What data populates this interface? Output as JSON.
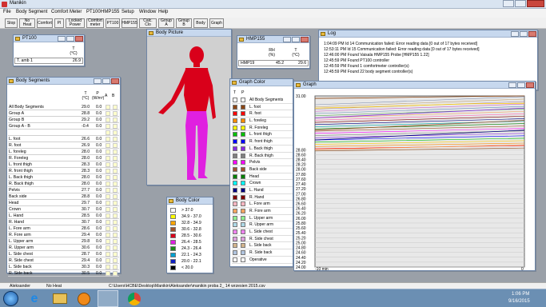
{
  "app": {
    "title": "Manikin"
  },
  "menu": [
    "File",
    "Body Segment",
    "Comfort Meter",
    "PT100",
    "HMP155",
    "Setup",
    "Window",
    "Help"
  ],
  "toolbar": [
    "Stop",
    "No Heat",
    "Comfort",
    "PI",
    "Locked Power",
    "Comfort meter",
    "PT100",
    "HMP155",
    "Calc. Clo",
    "Group A",
    "Group B",
    "Body",
    "Graph"
  ],
  "pt100": {
    "title": "PT100",
    "col": "T",
    "unit": "(°C)",
    "row_label": "T. amb 1",
    "row_value": "26.9"
  },
  "hmp": {
    "title": "HMP155",
    "col_rh": "RH",
    "unit_rh": "(%)",
    "col_t": "T",
    "unit_t": "(°C)",
    "row_label": "HMP19",
    "rh": "45.2",
    "t": "29.6"
  },
  "log": {
    "title": "Log",
    "lines": [
      "1:04:09 PM Id 14 Communication failed: Error reading data [0 out of 17 bytes received]",
      "12:53:11 PM Id 15 Communication failed: Error reading data [0 out of 17 bytes received]",
      "12:46:00 PM Found Vaisala HMP155 Probe [HMP155 1.22]",
      "12:45:59 PM Found PT100 controller",
      "12:45:59 PM Found 1 comfortmeter controller(s)",
      "12:45:59 PM Found 22 body segment controller(s)"
    ]
  },
  "segments": {
    "title": "Body Segments",
    "headers": [
      "T",
      "P",
      "A",
      "B"
    ],
    "units": [
      "(°C)",
      "(W/m²)"
    ],
    "rows": [
      {
        "name": "All Body Segments",
        "t": "29.0",
        "p": "0.0"
      },
      {
        "name": "Group A",
        "t": "28.8",
        "p": "0.0"
      },
      {
        "name": "Group B",
        "t": "29.2",
        "p": "0.0"
      },
      {
        "name": "Group A - B",
        "t": "-0.4",
        "p": "0.0"
      },
      {
        "name": "",
        "t": "",
        "p": ""
      },
      {
        "name": "L. foot",
        "t": "26.6",
        "p": "0.0"
      },
      {
        "name": "R. foot",
        "t": "26.9",
        "p": "0.0"
      },
      {
        "name": "L. foreleg",
        "t": "28.0",
        "p": "0.0"
      },
      {
        "name": "R. Foreleg",
        "t": "28.0",
        "p": "0.0"
      },
      {
        "name": "L. front thigh",
        "t": "28.3",
        "p": "0.0"
      },
      {
        "name": "R. front thigh",
        "t": "28.3",
        "p": "0.0"
      },
      {
        "name": "L. Back thigh",
        "t": "28.0",
        "p": "0.0"
      },
      {
        "name": "R. Back thigh",
        "t": "28.0",
        "p": "0.0"
      },
      {
        "name": "Pelvis",
        "t": "27.7",
        "p": "0.0"
      },
      {
        "name": "Back side",
        "t": "28.8",
        "p": "0.0"
      },
      {
        "name": "Head",
        "t": "29.7",
        "p": "0.0"
      },
      {
        "name": "Crown",
        "t": "30.7",
        "p": "0.0"
      },
      {
        "name": "L. Hand",
        "t": "28.5",
        "p": "0.0"
      },
      {
        "name": "R. Hand",
        "t": "30.7",
        "p": "0.0"
      },
      {
        "name": "L. Fore arm",
        "t": "28.6",
        "p": "0.0"
      },
      {
        "name": "R. Fore arm",
        "t": "29.4",
        "p": "0.0"
      },
      {
        "name": "L. Upper arm",
        "t": "29.8",
        "p": "0.0"
      },
      {
        "name": "R. Upper arm",
        "t": "30.6",
        "p": "0.0"
      },
      {
        "name": "L. Side chest",
        "t": "28.7",
        "p": "0.0"
      },
      {
        "name": "R. Side chest",
        "t": "29.4",
        "p": "0.0"
      },
      {
        "name": "L. Side back",
        "t": "30.3",
        "p": "0.0"
      },
      {
        "name": "R. Side back",
        "t": "30.5",
        "p": "0.0"
      }
    ]
  },
  "body_picture": {
    "title": "Body Picture"
  },
  "body_color": {
    "title": "Body Color",
    "ranges": [
      {
        "label": "> 37.0",
        "color": "#ffffff"
      },
      {
        "label": "34.9 - 37.0",
        "color": "#ffff00"
      },
      {
        "label": "32.8 - 34.9",
        "color": "#ffa500"
      },
      {
        "label": "30.6 - 32.8",
        "color": "#a0522d"
      },
      {
        "label": "28.5 - 30.6",
        "color": "#d9001a"
      },
      {
        "label": "26.4 - 28.5",
        "color": "#e020e0"
      },
      {
        "label": "24.3 - 26.4",
        "color": "#1a8a1a"
      },
      {
        "label": "22.1 - 24.3",
        "color": "#00a0d0"
      },
      {
        "label": "20.0 - 22.1",
        "color": "#1020c0"
      },
      {
        "label": "< 20.0",
        "color": "#000000"
      }
    ]
  },
  "graph_color": {
    "title": "Graph Color",
    "headers": [
      "T",
      "P"
    ],
    "rows": [
      {
        "name": "All Body Segments",
        "color": "#ffffff"
      },
      {
        "name": "L. foot",
        "color": "#8b4513"
      },
      {
        "name": "R. foot",
        "color": "#ff0000"
      },
      {
        "name": "L. foreleg",
        "color": "#ff8c00"
      },
      {
        "name": "R. Foreleg",
        "color": "#ffff00"
      },
      {
        "name": "L. front thigh",
        "color": "#00c000"
      },
      {
        "name": "R. front thigh",
        "color": "#0000ff"
      },
      {
        "name": "L. Back thigh",
        "color": "#8a2be2"
      },
      {
        "name": "R. Back thigh",
        "color": "#808080"
      },
      {
        "name": "Pelvis",
        "color": "#ff00ff"
      },
      {
        "name": "Back side",
        "color": "#a0522d"
      },
      {
        "name": "Head",
        "color": "#008000"
      },
      {
        "name": "Crown",
        "color": "#00ffff"
      },
      {
        "name": "L. Hand",
        "color": "#000080"
      },
      {
        "name": "R. Hand",
        "color": "#800000"
      },
      {
        "name": "L. Fore arm",
        "color": "#ffb6c1"
      },
      {
        "name": "R. Fore arm",
        "color": "#f4a460"
      },
      {
        "name": "L. Upper arm",
        "color": "#90ee90"
      },
      {
        "name": "R. Upper arm",
        "color": "#add8e6"
      },
      {
        "name": "L. Side chest",
        "color": "#ee82ee"
      },
      {
        "name": "R. Side chest",
        "color": "#dda0dd"
      },
      {
        "name": "L. Side back",
        "color": "#d2b48c"
      },
      {
        "name": "R. Side back",
        "color": "#b0c4de"
      },
      {
        "name": "Operative",
        "color": "#ffffff"
      }
    ]
  },
  "graph": {
    "title": "Graph",
    "x_min_label": "-10 min",
    "x_max_label": "0",
    "ytick_top": "31.00",
    "yticks": [
      "28.80",
      "28.60",
      "28.40",
      "28.20",
      "28.00",
      "27.80",
      "27.60",
      "27.40",
      "27.20",
      "27.00",
      "26.80",
      "26.60",
      "26.40",
      "26.20",
      "26.00",
      "25.80",
      "25.60",
      "25.40",
      "25.20",
      "25.00",
      "24.80",
      "24.60",
      "24.40",
      "24.20",
      "24.00"
    ]
  },
  "chart_data": {
    "type": "line",
    "title": "",
    "xlabel": "",
    "ylabel": "",
    "ylim": [
      24.0,
      31.0
    ],
    "xlim": [
      -10,
      0
    ],
    "series": [
      {
        "values": [
          30.9,
          30.92,
          30.95,
          30.98,
          31.0
        ]
      },
      {
        "values": [
          30.5,
          30.55,
          30.62,
          30.68,
          30.7
        ]
      },
      {
        "values": [
          30.1,
          30.2,
          30.3,
          30.4,
          30.5
        ]
      },
      {
        "values": [
          29.6,
          29.7,
          29.8,
          29.9,
          30.0
        ]
      },
      {
        "values": [
          29.2,
          29.3,
          29.4,
          29.5,
          29.6
        ]
      },
      {
        "values": [
          28.8,
          28.85,
          28.9,
          28.95,
          29.0
        ]
      }
    ]
  },
  "status": {
    "user": "Aleksander",
    "heat": "No Heat",
    "path": "C:\\Users\\HCBE\\Desktop\\Manikin\\Aleksander\\manikin proba 2_ 14 wrzesien 2015.csv"
  },
  "clock": {
    "time": "1:06 PM",
    "date": "9/16/2015"
  }
}
